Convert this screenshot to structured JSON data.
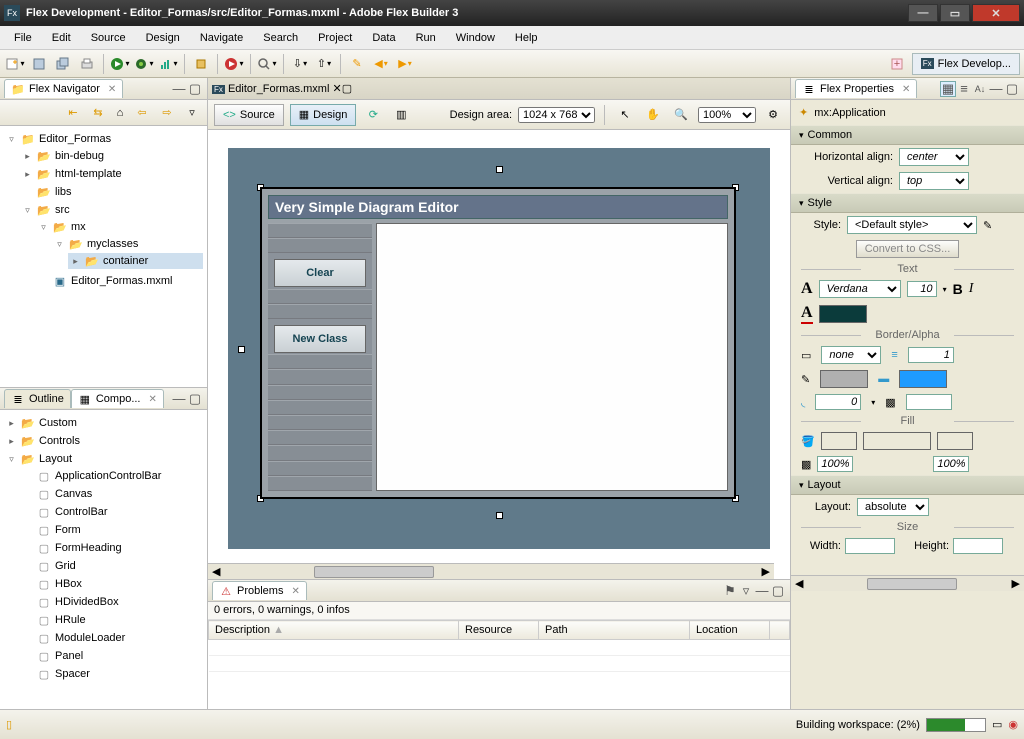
{
  "window": {
    "title": "Flex Development - Editor_Formas/src/Editor_Formas.mxml - Adobe Flex Builder 3"
  },
  "menu": [
    "File",
    "Edit",
    "Source",
    "Design",
    "Navigate",
    "Search",
    "Project",
    "Data",
    "Run",
    "Window",
    "Help"
  ],
  "perspective": {
    "label": "Flex Develop..."
  },
  "navigator": {
    "title": "Flex Navigator",
    "project": "Editor_Formas",
    "folders": {
      "binDebug": "bin-debug",
      "htmlTemplate": "html-template",
      "libs": "libs",
      "src": "src",
      "mx": "mx",
      "myclasses": "myclasses",
      "container": "container",
      "mainFile": "Editor_Formas.mxml"
    }
  },
  "outline": {
    "outlineLabel": "Outline",
    "componentsLabel": "Compo...",
    "groups": {
      "custom": "Custom",
      "controls": "Controls",
      "layout": "Layout"
    },
    "layoutItems": [
      "ApplicationControlBar",
      "Canvas",
      "ControlBar",
      "Form",
      "FormHeading",
      "Grid",
      "HBox",
      "HDividedBox",
      "HRule",
      "ModuleLoader",
      "Panel",
      "Spacer"
    ]
  },
  "editor": {
    "tabLabel": "Editor_Formas.mxml",
    "sourceLabel": "Source",
    "designLabel": "Design",
    "designAreaLabel": "Design area:",
    "designAreaValue": "1024 x 768",
    "zoom": "100%",
    "app": {
      "title": "Very Simple Diagram Editor",
      "clear": "Clear",
      "newClass": "New Class"
    }
  },
  "properties": {
    "title": "Flex Properties",
    "component": "mx:Application",
    "sections": {
      "common": "Common",
      "style": "Style",
      "layout": "Layout"
    },
    "labels": {
      "hAlign": "Horizontal align:",
      "vAlign": "Vertical align:",
      "style": "Style:",
      "convert": "Convert to CSS...",
      "text": "Text",
      "borderAlpha": "Border/Alpha",
      "fill": "Fill",
      "layout": "Layout:",
      "size": "Size",
      "width": "Width:",
      "height": "Height:"
    },
    "values": {
      "hAlign": "center",
      "vAlign": "top",
      "style": "<Default style>",
      "font": "Verdana",
      "fontSize": "10",
      "borderStyle": "none",
      "borderWeight": "1",
      "cornerRadius": "0",
      "alpha1": "100%",
      "alpha2": "100%",
      "layout": "absolute",
      "width": "",
      "height": ""
    },
    "colors": {
      "textColor": "#0b3b3b",
      "borderColor": "#b0b0b0",
      "highlight": "#1e9bff"
    }
  },
  "problems": {
    "title": "Problems",
    "summary": "0 errors, 0 warnings, 0 infos",
    "columns": [
      "Description",
      "Resource",
      "Path",
      "Location"
    ]
  },
  "status": {
    "building": "Building workspace: (2%)"
  }
}
